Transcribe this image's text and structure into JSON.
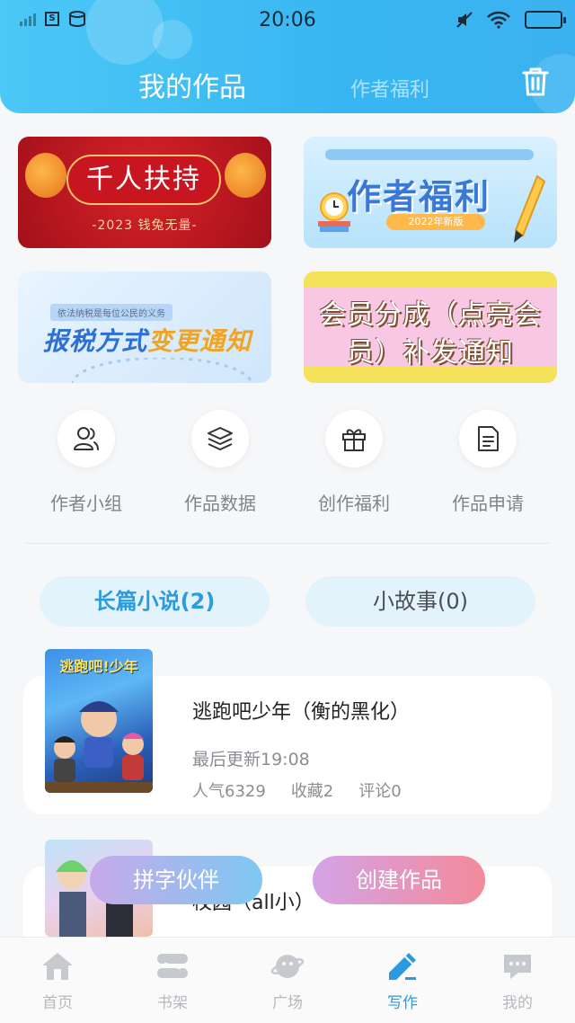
{
  "status_bar": {
    "time": "20:06",
    "sim_badge": "S"
  },
  "header": {
    "title": "我的作品",
    "secondary_tab": "作者福利",
    "trash_icon": "trash-icon"
  },
  "banners": [
    {
      "title": "千人扶持",
      "subtitle": "-2023 钱兔无量-"
    },
    {
      "title": "作者福利",
      "tag": "2022年新版"
    },
    {
      "small_text": "依法纳税是每位公民的义务",
      "title_part1": "报税方式",
      "title_part2": "变更通知"
    },
    {
      "line1": "会员分成（点亮会",
      "line2": "员）补发通知"
    }
  ],
  "shortcuts": [
    {
      "label": "作者小组",
      "icon": "users-icon"
    },
    {
      "label": "作品数据",
      "icon": "layers-icon"
    },
    {
      "label": "创作福利",
      "icon": "gift-icon"
    },
    {
      "label": "作品申请",
      "icon": "document-icon"
    }
  ],
  "tabs": {
    "active": "长篇小说(2)",
    "inactive": "小故事(0)"
  },
  "works": [
    {
      "title": "逃跑吧少年（衡的黑化）",
      "updated": "最后更新19:08",
      "popularity": "人气6329",
      "favorites": "收藏2",
      "comments": "评论0",
      "cover_text": "逃跑吧!少年"
    },
    {
      "title": "校园（all小）"
    }
  ],
  "floating_buttons": {
    "left": "拼字伙伴",
    "right": "创建作品"
  },
  "bottom_nav": [
    {
      "label": "首页",
      "icon": "home-icon",
      "active": false
    },
    {
      "label": "书架",
      "icon": "bookshelf-icon",
      "active": false
    },
    {
      "label": "广场",
      "icon": "planet-icon",
      "active": false
    },
    {
      "label": "写作",
      "icon": "pen-icon",
      "active": true
    },
    {
      "label": "我的",
      "icon": "chat-bubble-icon",
      "active": false
    }
  ],
  "colors": {
    "accent": "#2a9be0",
    "header_gradient_start": "#4cc8f6",
    "header_gradient_end": "#3bb2ef"
  }
}
